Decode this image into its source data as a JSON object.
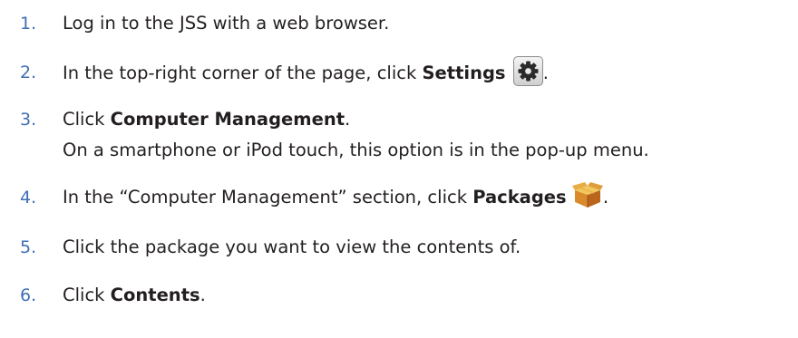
{
  "steps": [
    {
      "number": "1.",
      "text": "Log in to the JSS with a web browser."
    },
    {
      "number": "2.",
      "before": "In the top-right corner of the page, click ",
      "bold": "Settings",
      "after": ".",
      "icon": "gear-icon"
    },
    {
      "number": "3.",
      "before": "Click ",
      "bold": "Computer Management",
      "after": ".",
      "note": "On a smartphone or iPod touch, this option is in the pop-up menu."
    },
    {
      "number": "4.",
      "before": "In the “Computer Management” section, click ",
      "bold": "Packages",
      "after": ".",
      "icon": "package-icon"
    },
    {
      "number": "5.",
      "text": "Click the package you want to view the contents of."
    },
    {
      "number": "6.",
      "before": "Click ",
      "bold": "Contents",
      "after": "."
    }
  ],
  "colors": {
    "number": "#3f6fb4",
    "text": "#231f20"
  }
}
